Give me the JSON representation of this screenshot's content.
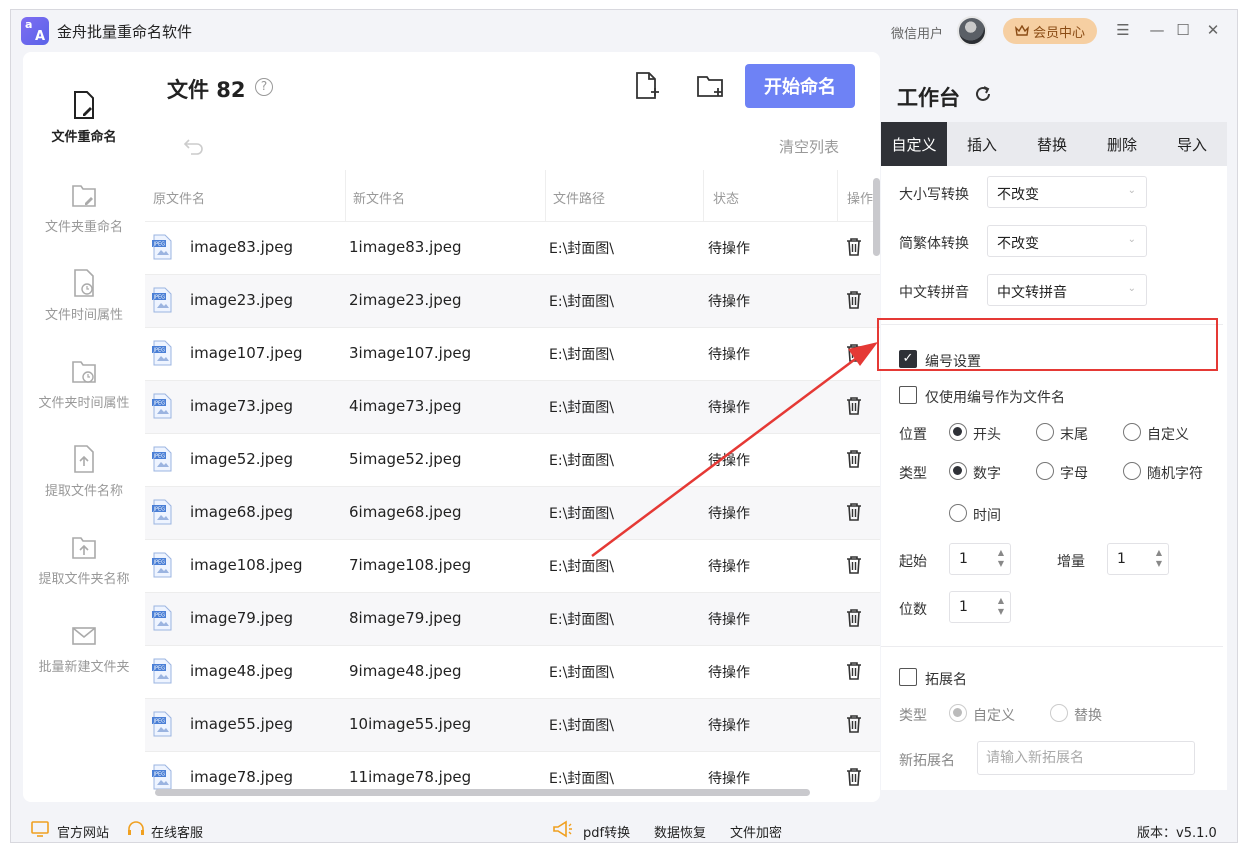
{
  "app": {
    "title": "金舟批量重命名软件",
    "logo_text_1": "a",
    "logo_text_2": "A",
    "user_name": "微信用户",
    "vip_label": "会员中心"
  },
  "sidebar": {
    "items": [
      {
        "label": "文件重命名",
        "active": true,
        "icon": "file-edit-icon"
      },
      {
        "label": "文件夹重命名",
        "active": false,
        "icon": "folder-edit-icon"
      },
      {
        "label": "文件时间属性",
        "active": false,
        "icon": "file-clock-icon"
      },
      {
        "label": "文件夹时间属性",
        "active": false,
        "icon": "folder-clock-icon"
      },
      {
        "label": "提取文件名称",
        "active": false,
        "icon": "file-upload-icon"
      },
      {
        "label": "提取文件夹名称",
        "active": false,
        "icon": "folder-upload-icon"
      },
      {
        "label": "批量新建文件夹",
        "active": false,
        "icon": "envelope-icon"
      }
    ]
  },
  "file_panel": {
    "file_count_label": "文件 82",
    "help_glyph": "?",
    "start_button": "开始命名",
    "clear_list": "清空列表",
    "columns": [
      "原文件名",
      "新文件名",
      "文件路径",
      "状态",
      "操作"
    ],
    "rows": [
      {
        "original": "image83.jpeg",
        "new": "1image83.jpeg",
        "path": "E:\\封面图\\",
        "status": "待操作"
      },
      {
        "original": "image23.jpeg",
        "new": "2image23.jpeg",
        "path": "E:\\封面图\\",
        "status": "待操作"
      },
      {
        "original": "image107.jpeg",
        "new": "3image107.jpeg",
        "path": "E:\\封面图\\",
        "status": "待操作"
      },
      {
        "original": "image73.jpeg",
        "new": "4image73.jpeg",
        "path": "E:\\封面图\\",
        "status": "待操作"
      },
      {
        "original": "image52.jpeg",
        "new": "5image52.jpeg",
        "path": "E:\\封面图\\",
        "status": "待操作"
      },
      {
        "original": "image68.jpeg",
        "new": "6image68.jpeg",
        "path": "E:\\封面图\\",
        "status": "待操作"
      },
      {
        "original": "image108.jpeg",
        "new": "7image108.jpeg",
        "path": "E:\\封面图\\",
        "status": "待操作"
      },
      {
        "original": "image79.jpeg",
        "new": "8image79.jpeg",
        "path": "E:\\封面图\\",
        "status": "待操作"
      },
      {
        "original": "image48.jpeg",
        "new": "9image48.jpeg",
        "path": "E:\\封面图\\",
        "status": "待操作"
      },
      {
        "original": "image55.jpeg",
        "new": "10image55.jpeg",
        "path": "E:\\封面图\\",
        "status": "待操作"
      },
      {
        "original": "image78.jpeg",
        "new": "11image78.jpeg",
        "path": "E:\\封面图\\",
        "status": "待操作"
      }
    ]
  },
  "workbench": {
    "title": "工作台",
    "tabs": [
      {
        "label": "自定义",
        "active": true
      },
      {
        "label": "插入",
        "active": false
      },
      {
        "label": "替换",
        "active": false
      },
      {
        "label": "删除",
        "active": false
      },
      {
        "label": "导入",
        "active": false
      }
    ],
    "case_label": "大小写转换",
    "case_value": "不改变",
    "trad_label": "简繁体转换",
    "trad_value": "不改变",
    "pinyin_label": "中文转拼音",
    "pinyin_value": "中文转拼音",
    "numbering_label": "编号设置",
    "numbering_checked": true,
    "only_number_label": "仅使用编号作为文件名",
    "only_number_checked": false,
    "position_label": "位置",
    "position_options": [
      "开头",
      "末尾",
      "自定义"
    ],
    "position_selected": "开头",
    "type_label": "类型",
    "type_options": [
      "数字",
      "字母",
      "随机字符",
      "时间"
    ],
    "type_selected": "数字",
    "start_label": "起始",
    "start_value": "1",
    "step_label": "增量",
    "step_value": "1",
    "digits_label": "位数",
    "digits_value": "1",
    "extension_label": "拓展名",
    "extension_checked": false,
    "ext_type_label": "类型",
    "ext_type_options": [
      "自定义",
      "替换"
    ],
    "ext_type_selected": "自定义",
    "new_ext_label": "新拓展名",
    "new_ext_placeholder": "请输入新拓展名"
  },
  "footer": {
    "official_site": "官方网站",
    "online_service": "在线客服",
    "pdf_convert": "pdf转换",
    "data_recovery": "数据恢复",
    "file_encrypt": "文件加密",
    "version": "版本：v5.1.0"
  },
  "annotation_color": "#e53935"
}
